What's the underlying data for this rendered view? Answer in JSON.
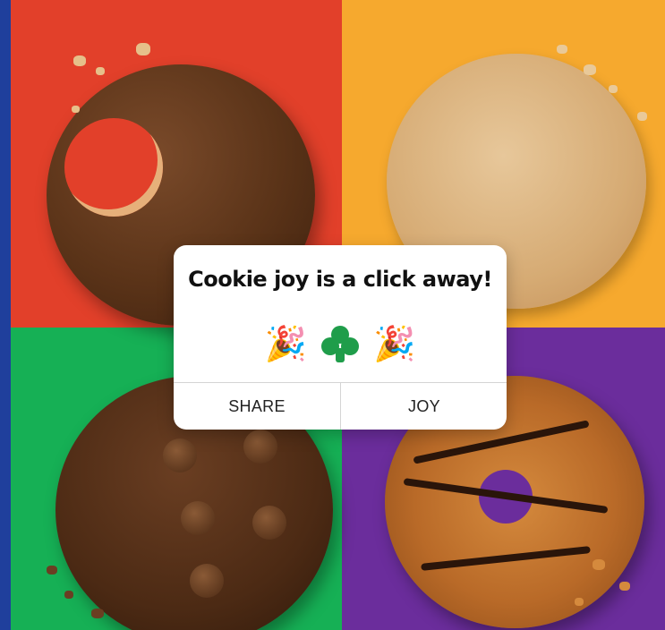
{
  "dialog": {
    "title": "Cookie joy is a click away!",
    "icons": [
      "party-popper-icon",
      "trefoil-icon",
      "party-popper-icon"
    ],
    "party_glyph": "🎉",
    "buttons": {
      "share_label": "SHARE",
      "joy_label": "JOY"
    }
  },
  "colors": {
    "border": "#1f3f9c",
    "top_left_bg": "#e2402a",
    "top_right_bg": "#f6a92e",
    "bottom_left_bg": "#16b055",
    "bottom_right_bg": "#6b2d9c",
    "trefoil": "#1f9d4a"
  }
}
